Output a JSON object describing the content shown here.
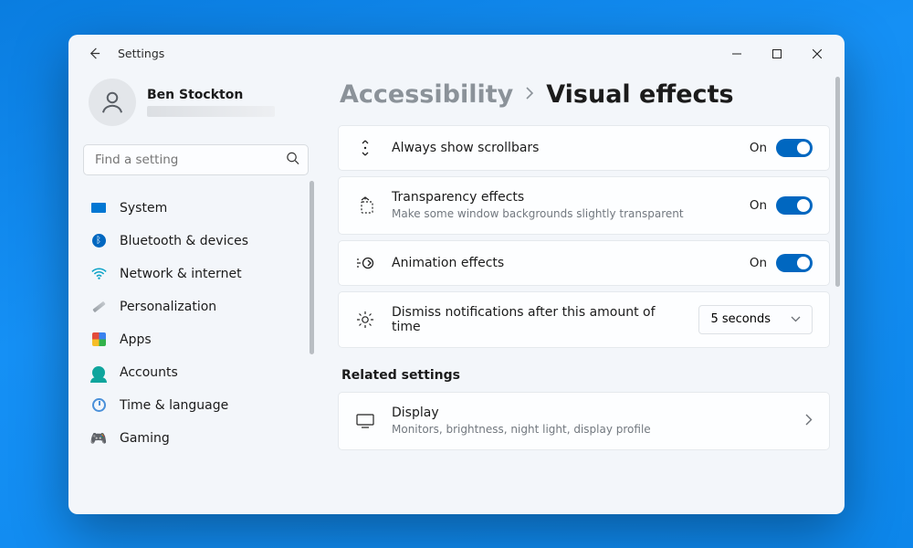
{
  "window": {
    "title": "Settings"
  },
  "profile": {
    "name": "Ben Stockton"
  },
  "search": {
    "placeholder": "Find a setting"
  },
  "sidebar": {
    "items": [
      {
        "label": "System"
      },
      {
        "label": "Bluetooth & devices"
      },
      {
        "label": "Network & internet"
      },
      {
        "label": "Personalization"
      },
      {
        "label": "Apps"
      },
      {
        "label": "Accounts"
      },
      {
        "label": "Time & language"
      },
      {
        "label": "Gaming"
      }
    ]
  },
  "breadcrumb": {
    "parent": "Accessibility",
    "current": "Visual effects"
  },
  "settings": {
    "scrollbars": {
      "title": "Always show scrollbars",
      "state": "On"
    },
    "transparency": {
      "title": "Transparency effects",
      "subtitle": "Make some window backgrounds slightly transparent",
      "state": "On"
    },
    "animation": {
      "title": "Animation effects",
      "state": "On"
    },
    "dismiss": {
      "title": "Dismiss notifications after this amount of time",
      "value": "5 seconds"
    }
  },
  "related": {
    "heading": "Related settings",
    "display": {
      "title": "Display",
      "subtitle": "Monitors, brightness, night light, display profile"
    }
  }
}
